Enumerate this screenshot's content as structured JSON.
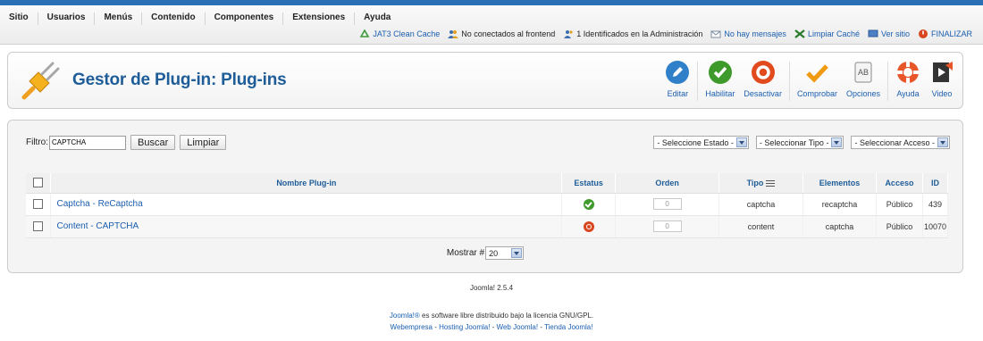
{
  "menu": [
    "Sitio",
    "Usuarios",
    "Menús",
    "Contenido",
    "Componentes",
    "Extensiones",
    "Ayuda"
  ],
  "status_bar": {
    "jat3": "JAT3 Clean Cache",
    "frontend": "No conectados al frontend",
    "admin": "1 Identificados en la Administración",
    "messages": "No hay mensajes",
    "cache": "Limpiar Caché",
    "site": "Ver sitio",
    "logout": "FINALIZAR"
  },
  "header": {
    "title": "Gestor de Plug-in: Plug-ins"
  },
  "toolbar": {
    "edit": "Editar",
    "enable": "Habilitar",
    "disable": "Desactivar",
    "check": "Comprobar",
    "options": "Opciones",
    "help": "Ayuda",
    "video": "Video"
  },
  "filter": {
    "label": "Filtro:",
    "value": "CAPTCHA",
    "search_label": "Buscar",
    "clear_label": "Limpiar",
    "state_select": "- Seleccione Estado -",
    "type_select": "- Seleccionar Tipo -",
    "access_select": "- Seleccionar Acceso -"
  },
  "table": {
    "columns": {
      "name": "Nombre Plug-in",
      "status": "Estatus",
      "order": "Orden",
      "type": "Tipo",
      "element": "Elementos",
      "access": "Acceso",
      "id": "ID"
    },
    "rows": [
      {
        "name": "Captcha - ReCaptcha",
        "status": "enabled",
        "order": "0",
        "type": "captcha",
        "element": "recaptcha",
        "access": "Público",
        "id": "439"
      },
      {
        "name": "Content - CAPTCHA",
        "status": "disabled",
        "order": "0",
        "type": "content",
        "element": "captcha",
        "access": "Público",
        "id": "10070"
      }
    ]
  },
  "pager": {
    "label": "Mostrar #",
    "value": "20"
  },
  "footer": {
    "version": "Joomla! 2.5.4",
    "license_link": "Joomla!®",
    "license_text": " es software libre distribuido bajo la licencia GNU/GPL.",
    "links": [
      "Webempresa",
      "Hosting Joomla!",
      "Web Joomla!",
      "Tienda Joomla!"
    ],
    "separator": " - "
  }
}
